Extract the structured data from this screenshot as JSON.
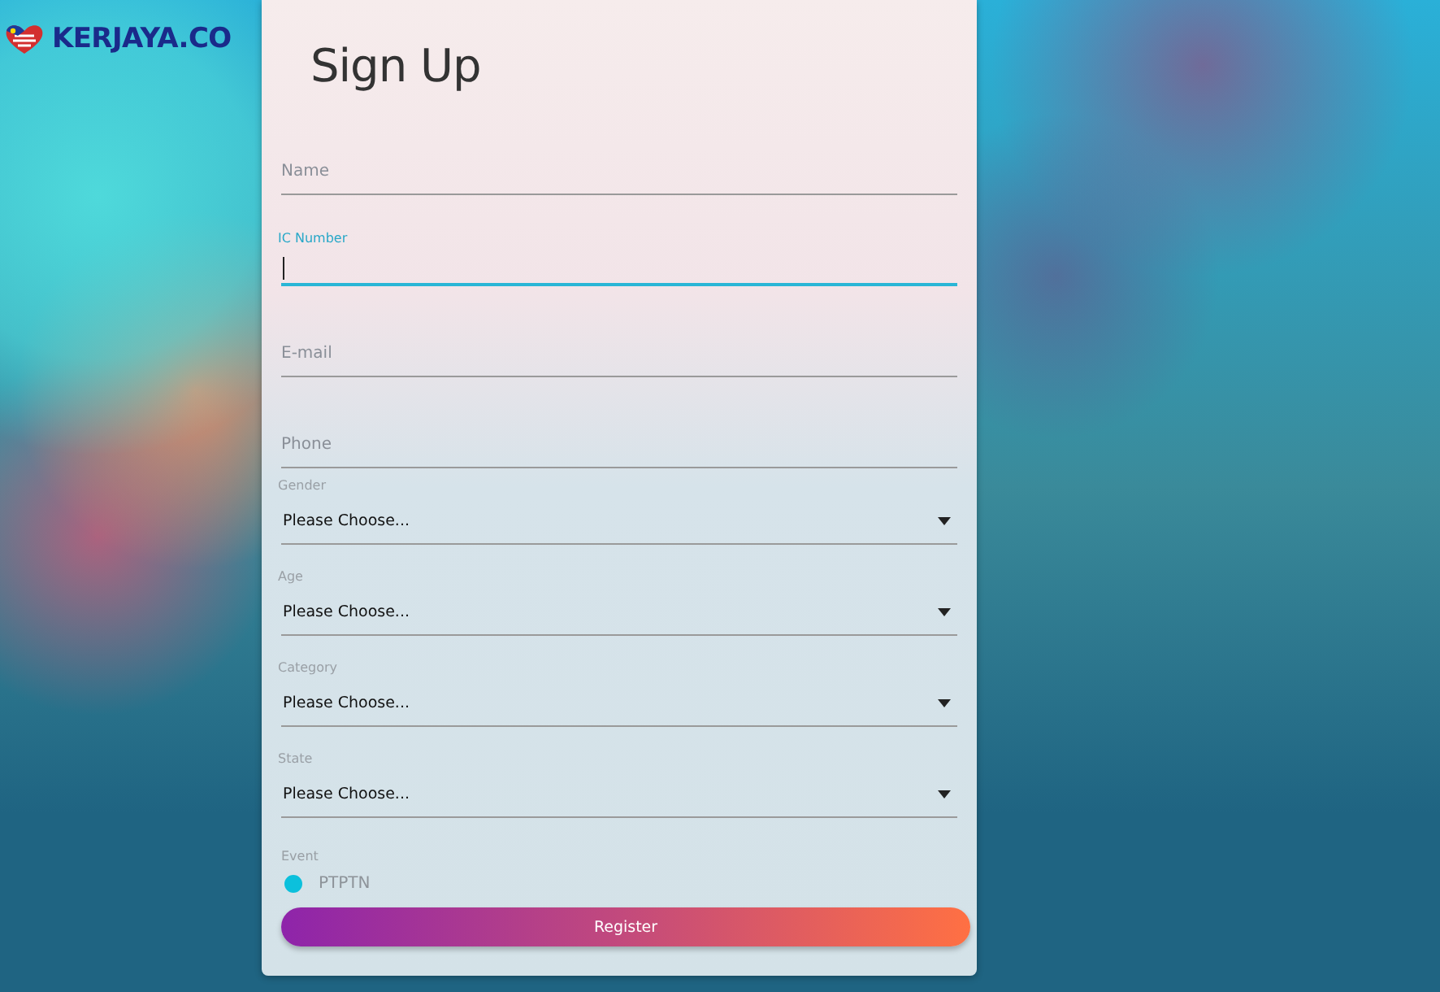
{
  "logo": {
    "text": "KERJAYA.CO"
  },
  "form": {
    "title": "Sign Up",
    "fields": [
      {
        "kind": "text",
        "label": "Name",
        "focused": false
      },
      {
        "kind": "text",
        "label": "IC Number",
        "focused": true
      },
      {
        "kind": "text",
        "label": "E-mail",
        "focused": false
      },
      {
        "kind": "text",
        "label": "Phone",
        "focused": false
      },
      {
        "kind": "select",
        "label": "Gender",
        "value": "Please Choose..."
      },
      {
        "kind": "select",
        "label": "Age",
        "value": "Please Choose..."
      },
      {
        "kind": "select",
        "label": "Category",
        "value": "Please Choose..."
      },
      {
        "kind": "select",
        "label": "State",
        "value": "Please Choose..."
      }
    ],
    "event": {
      "label": "Event",
      "options": [
        {
          "label": "PTPTN",
          "selected": true
        }
      ]
    },
    "submit": "Register"
  }
}
